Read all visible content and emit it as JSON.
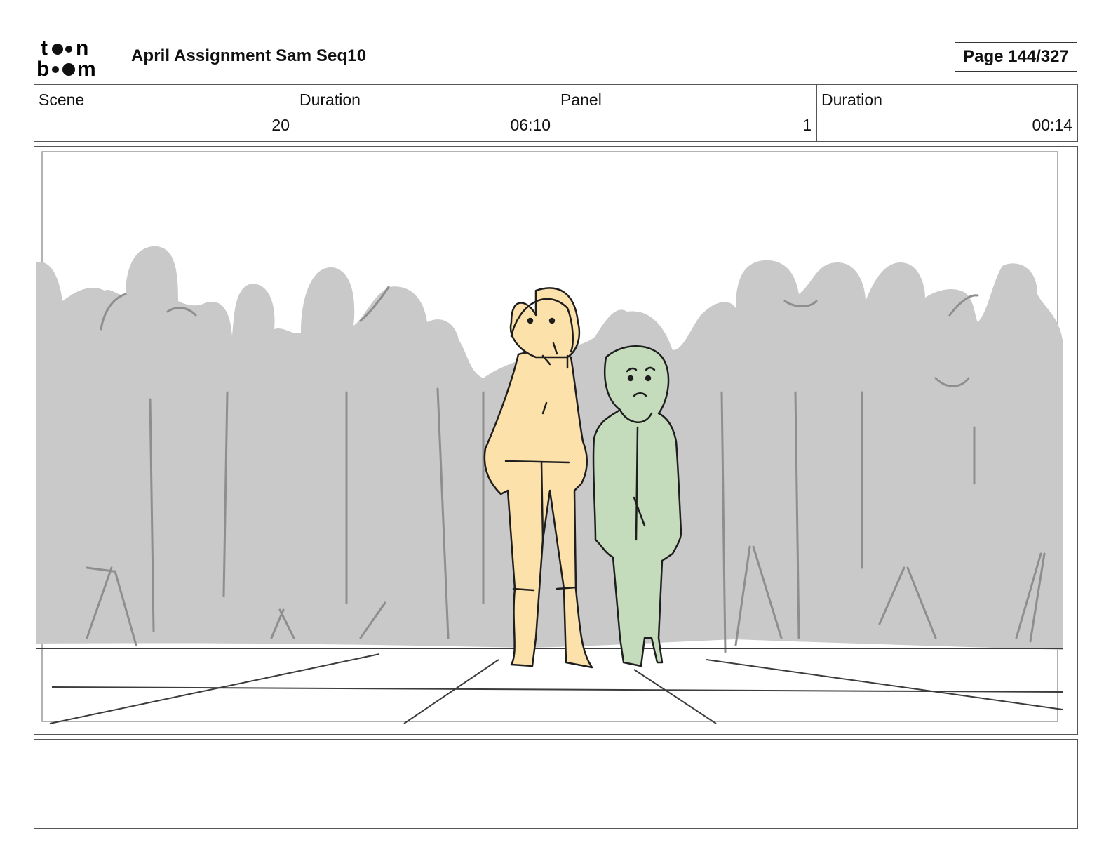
{
  "header": {
    "logo_text": [
      "to",
      "n",
      "b",
      "om"
    ],
    "project_title": "April Assignment Sam Seq10",
    "page_label": "Page 144/327"
  },
  "info": {
    "scene_label": "Scene",
    "scene_value": "20",
    "scene_duration_label": "Duration",
    "scene_duration_value": "06:10",
    "panel_label": "Panel",
    "panel_value": "1",
    "panel_duration_label": "Duration",
    "panel_duration_value": "00:14"
  },
  "panel": {
    "colors": {
      "crowd": "#c9c9c9",
      "crowd_lines": "#8e8e8e",
      "character_left": "#fde1aa",
      "character_right": "#c4dcbc",
      "ink": "#1e1e1e"
    }
  },
  "notes": {
    "text": ""
  }
}
